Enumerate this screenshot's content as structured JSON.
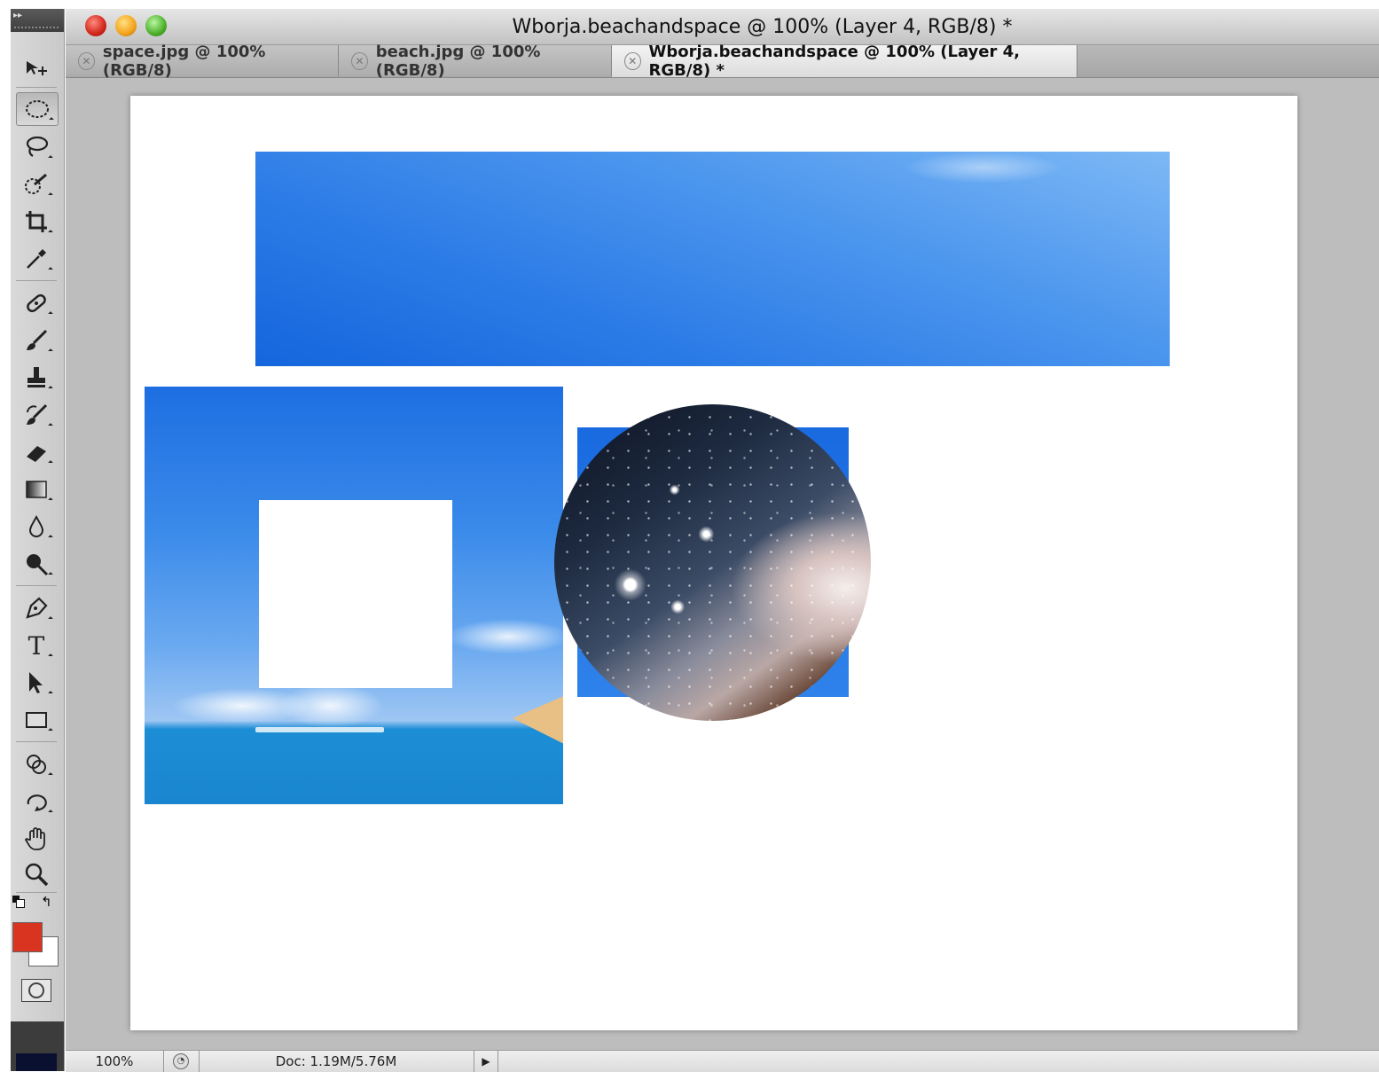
{
  "window": {
    "title": "Wborja.beachandspace @ 100% (Layer 4, RGB/8) *"
  },
  "tabs": [
    {
      "label": "space.jpg @ 100% (RGB/8)",
      "active": false
    },
    {
      "label": "beach.jpg @ 100% (RGB/8)",
      "active": false
    },
    {
      "label": "Wborja.beachandspace @ 100% (Layer 4, RGB/8) *",
      "active": true
    }
  ],
  "tools": [
    {
      "icon": "move-tool-icon",
      "glyph": "▸✣"
    },
    {
      "icon": "elliptical-marquee-tool-icon",
      "glyph": "◯",
      "active": true
    },
    {
      "icon": "lasso-tool-icon",
      "glyph": "ϙ"
    },
    {
      "icon": "quick-selection-tool-icon",
      "glyph": "✎"
    },
    {
      "icon": "crop-tool-icon",
      "glyph": "⌗"
    },
    {
      "icon": "eyedropper-tool-icon",
      "glyph": "✒"
    },
    {
      "icon": "healing-brush-tool-icon",
      "glyph": "✚"
    },
    {
      "icon": "brush-tool-icon",
      "glyph": "🖌"
    },
    {
      "icon": "clone-stamp-tool-icon",
      "glyph": "⊥"
    },
    {
      "icon": "history-brush-tool-icon",
      "glyph": "↺"
    },
    {
      "icon": "eraser-tool-icon",
      "glyph": "▰"
    },
    {
      "icon": "gradient-tool-icon",
      "glyph": "▤"
    },
    {
      "icon": "blur-tool-icon",
      "glyph": "💧"
    },
    {
      "icon": "dodge-tool-icon",
      "glyph": "●"
    },
    {
      "icon": "pen-tool-icon",
      "glyph": "✑"
    },
    {
      "icon": "type-tool-icon",
      "glyph": "T"
    },
    {
      "icon": "path-selection-tool-icon",
      "glyph": "➤"
    },
    {
      "icon": "rectangle-tool-icon",
      "glyph": "▭"
    },
    {
      "icon": "3d-rotate-tool-icon",
      "glyph": "⟲"
    },
    {
      "icon": "3d-orbit-tool-icon",
      "glyph": "⟳"
    },
    {
      "icon": "hand-tool-icon",
      "glyph": "✋"
    },
    {
      "icon": "zoom-tool-icon",
      "glyph": "🔍"
    }
  ],
  "colors": {
    "foreground": "#d83420",
    "background": "#ffffff",
    "canvas": "#ffffff",
    "workspace": "#bdbdbd"
  },
  "status": {
    "zoom": "100%",
    "doc": "Doc: 1.19M/5.76M"
  }
}
